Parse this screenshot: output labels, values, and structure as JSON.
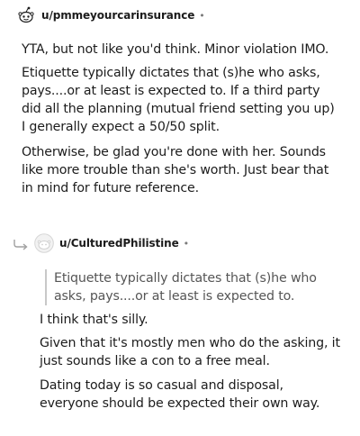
{
  "comments": [
    {
      "username": "u/pmmeyourcarinsurance",
      "avatar_icon": "snoo-avatar-icon",
      "separator": "•",
      "paragraphs": [
        "YTA, but not like you'd think. Minor violation IMO.",
        "Etiquette typically dictates that (s)he who asks, pays....or at least is expected to. If a third party did all the planning (mutual friend setting you up) I generally expect a 50/50 split.",
        "Otherwise, be glad you're done with her. Sounds like more trouble than she's worth. Just bear that in mind for future reference."
      ]
    },
    {
      "username": "u/CulturedPhilistine",
      "avatar_icon": "default-avatar-icon",
      "reply_icon": "reply-arrow-icon",
      "separator": "•",
      "quote": "Etiquette typically dictates that (s)he who asks, pays....or at least is expected to.",
      "paragraphs": [
        "I think that's silly.",
        "Given that it's mostly men who do the asking, it just sounds like a con to a free meal.",
        "Dating today is so casual and disposal, everyone should be expected their own way."
      ]
    }
  ]
}
